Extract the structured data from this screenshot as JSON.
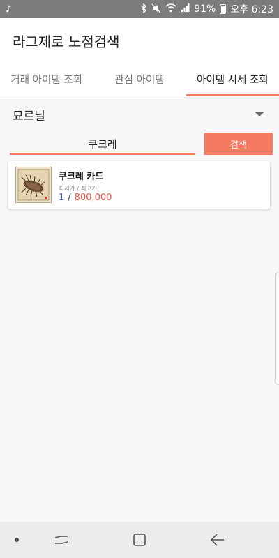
{
  "status_bar": {
    "battery": "91%",
    "time": "오후 6:23",
    "left_icon": "music-note-icon",
    "right_icons": [
      "bluetooth-icon",
      "mute-icon",
      "wifi-icon",
      "signal-icon",
      "battery-icon"
    ]
  },
  "app": {
    "title": "라그제로 노점검색"
  },
  "tabs": [
    {
      "label": "거래 아이템 조회",
      "active": false
    },
    {
      "label": "관심 아이템",
      "active": false
    },
    {
      "label": "아이템 시세 조회",
      "active": true
    }
  ],
  "filter": {
    "server": "묘르닐"
  },
  "search": {
    "value": "쿠크레",
    "button_label": "검색"
  },
  "results": [
    {
      "name": "쿠크레 카드",
      "price_label": "최저가 / 최고가",
      "min_price": "1",
      "separator": "/",
      "max_price": "800,000",
      "icon": "kukre-card-image"
    }
  ],
  "nav_bar": {
    "icons": [
      "dot-icon",
      "recent-apps-icon",
      "home-icon",
      "back-icon"
    ]
  },
  "colors": {
    "accent": "#f47a62",
    "min_price": "#3b5bc7",
    "max_price": "#e84c3d"
  }
}
